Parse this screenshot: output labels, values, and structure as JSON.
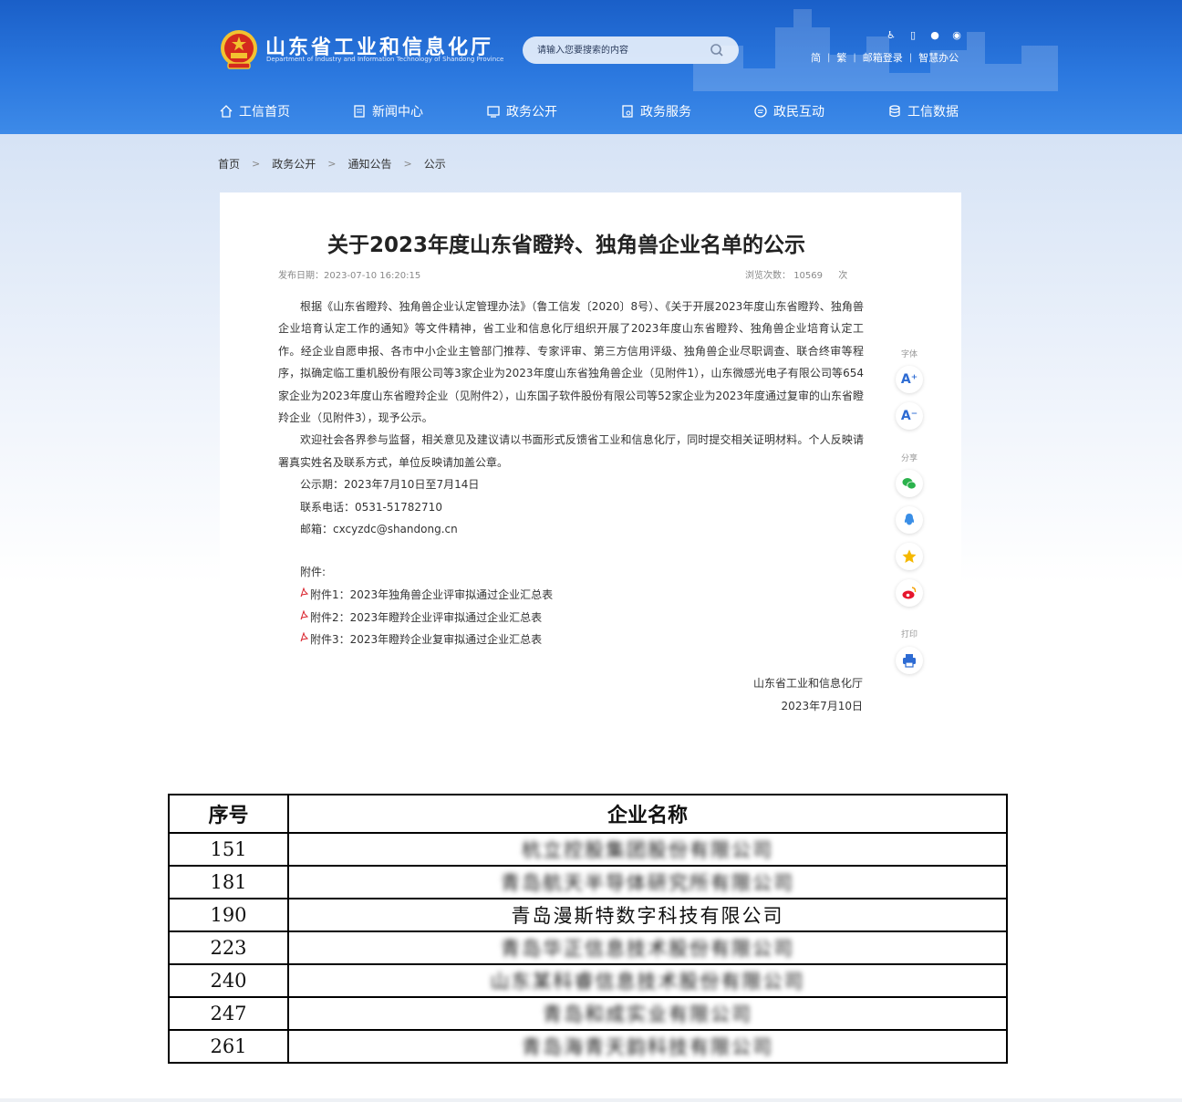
{
  "header": {
    "site_title": "山东省工业和信息化厅",
    "site_subtitle": "Department of Industry and Information Technology of Shandong Province",
    "search_placeholder": "请输入您要搜索的内容",
    "links": [
      "简",
      "繁",
      "邮箱登录",
      "智慧办公"
    ],
    "nav": [
      "工信首页",
      "新闻中心",
      "政务公开",
      "政务服务",
      "政民互动",
      "工信数据"
    ]
  },
  "breadcrumb": [
    "首页",
    "政务公开",
    "通知公告",
    "公示"
  ],
  "article": {
    "title": "关于2023年度山东省瞪羚、独角兽企业名单的公示",
    "publish_date": "发布日期：2023-07-10 16:20:15",
    "views_label": "浏览次数：",
    "views_count": "10569",
    "views_unit": "次",
    "para1": "根据《山东省瞪羚、独角兽企业认定管理办法》（鲁工信发〔2020〕8号）、《关于开展2023年度山东省瞪羚、独角兽企业培育认定工作的通知》等文件精神，省工业和信息化厅组织开展了2023年度山东省瞪羚、独角兽企业培育认定工作。经企业自愿申报、各市中小企业主管部门推荐、专家评审、第三方信用评级、独角兽企业尽职调查、联合终审等程序，拟确定临工重机股份有限公司等3家企业为2023年度山东省独角兽企业（见附件1），山东微感光电子有限公司等654家企业为2023年度山东省瞪羚企业（见附件2），山东国子软件股份有限公司等52家企业为2023年度通过复审的山东省瞪羚企业（见附件3），现予公示。",
    "para2": "欢迎社会各界参与监督，相关意见及建议请以书面形式反馈省工业和信息化厅，同时提交相关证明材料。个人反映请署真实姓名及联系方式，单位反映请加盖公章。",
    "period": "公示期：2023年7月10日至7月14日",
    "phone": "联系电话：0531-51782710",
    "email": "邮箱：cxcyzdc@shandong.cn",
    "attachments_label": "附件:",
    "attachments": [
      "附件1：2023年独角兽企业评审拟通过企业汇总表",
      "附件2：2023年瞪羚企业评审拟通过企业汇总表",
      "附件3：2023年瞪羚企业复审拟通过企业汇总表"
    ],
    "signature_org": "山东省工业和信息化厅",
    "signature_date": "2023年7月10日"
  },
  "side_tools": {
    "font_label": "字体",
    "font_increase": "A⁺",
    "font_decrease": "A⁻",
    "share_label": "分享",
    "print_label": "打印"
  },
  "table": {
    "headers": [
      "序号",
      "企业名称"
    ],
    "rows": [
      {
        "no": "151",
        "name": "杭立控股集团股份有限公司",
        "blurred": true
      },
      {
        "no": "181",
        "name": "青岛航天半导体研究所有限公司",
        "blurred": true
      },
      {
        "no": "190",
        "name": "青岛漫斯特数字科技有限公司",
        "blurred": false
      },
      {
        "no": "223",
        "name": "青岛华正信息技术股份有限公司",
        "blurred": true
      },
      {
        "no": "240",
        "name": "山东某科睿信息技术股份有限公司",
        "blurred": true
      },
      {
        "no": "247",
        "name": "青岛和成实业有限公司",
        "blurred": true
      },
      {
        "no": "261",
        "name": "青岛海青天韵科技有限公司",
        "blurred": true
      }
    ]
  },
  "colors": {
    "header_blue": "#2b78df",
    "tool_blue": "#2d6bd3",
    "wechat_green": "#2bb24c",
    "qq_blue": "#3a8ee6",
    "favorite_yellow": "#f5b800",
    "weibo_red": "#e6162d",
    "pdf_red": "#d9232d"
  }
}
